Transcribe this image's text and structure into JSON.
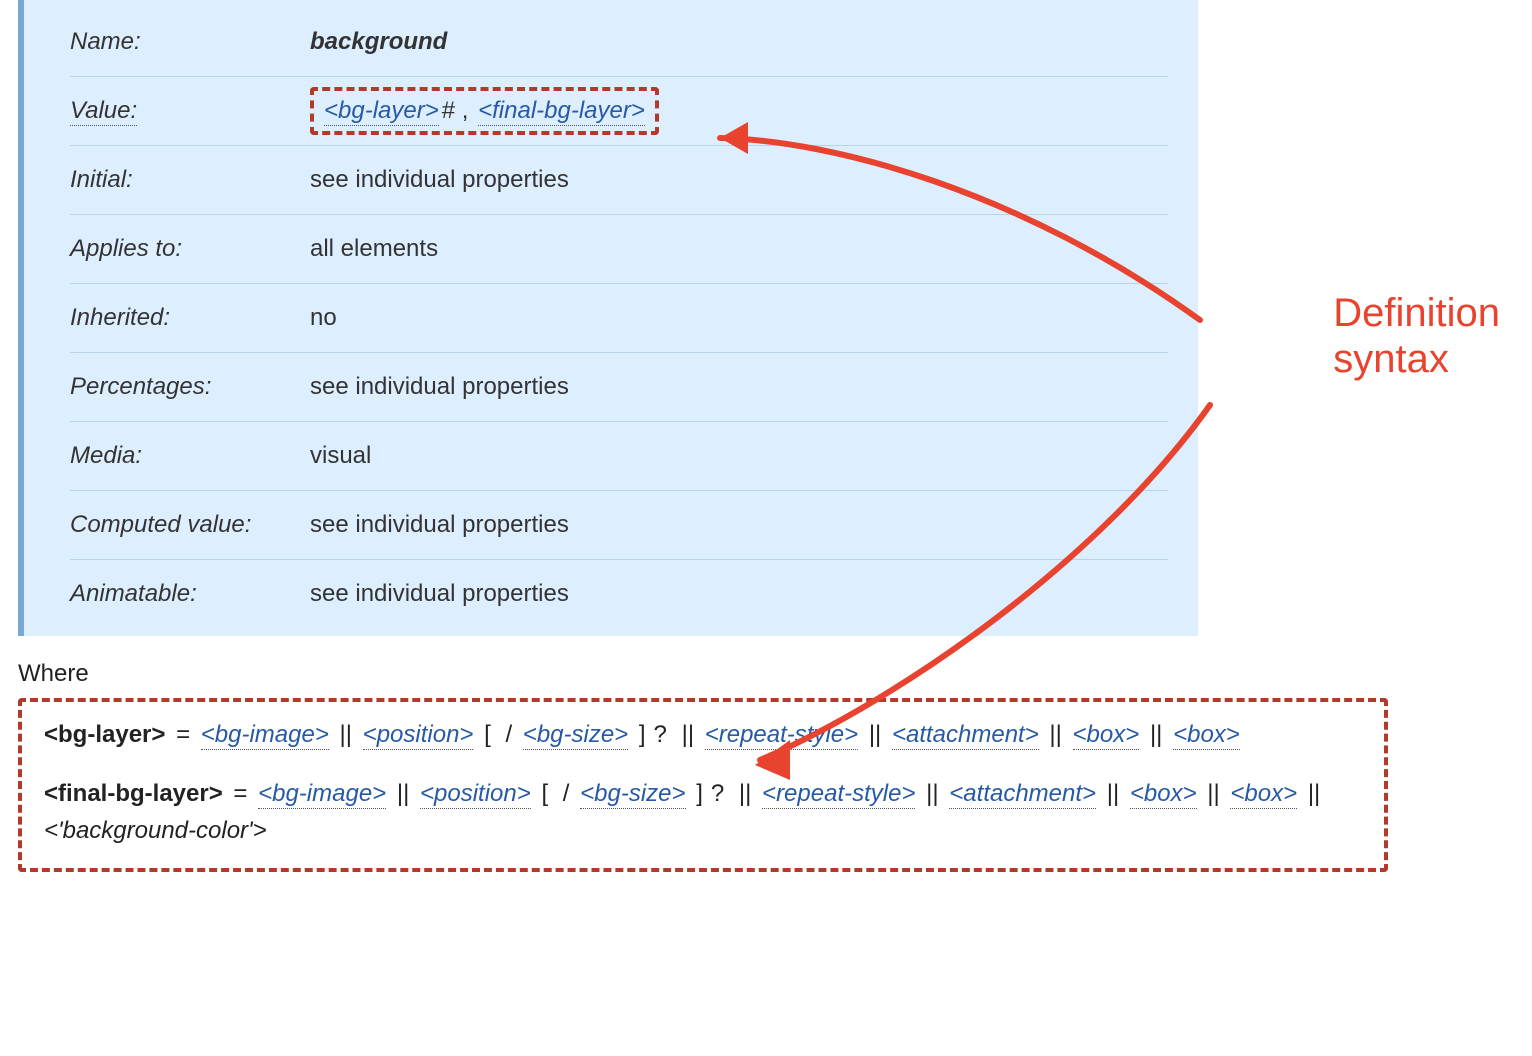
{
  "propdef": {
    "rows": [
      {
        "label": "Name:",
        "value_text": "background"
      },
      {
        "label": "Value:",
        "value_link1": "<bg-layer>",
        "value_sep": "# , ",
        "value_link2": "<final-bg-layer>"
      },
      {
        "label": "Initial:",
        "value_text": "see individual properties"
      },
      {
        "label": "Applies to:",
        "value_text": "all elements"
      },
      {
        "label": "Inherited:",
        "value_text": "no"
      },
      {
        "label": "Percentages:",
        "value_text": "see individual properties"
      },
      {
        "label": "Media:",
        "value_text": "visual"
      },
      {
        "label": "Computed value:",
        "value_text": "see individual properties"
      },
      {
        "label": "Animatable:",
        "value_text": "see individual properties"
      }
    ]
  },
  "where_heading": "Where",
  "where": {
    "line1_lhs": "<bg-layer>",
    "line2_lhs": "<final-bg-layer>",
    "eq": " = ",
    "tokens": {
      "bg_image": "<bg-image>",
      "position": "<position>",
      "bg_size": "<bg-size>",
      "repeat_style": "<repeat-style>",
      "attachment": "<attachment>",
      "box": "<box>",
      "bg_color": "<'background-color'>"
    },
    "ops": {
      "dbar": "||",
      "lbracket": "[",
      "rbracket": "]",
      "slash": "/",
      "qmark": "?"
    }
  },
  "annotation": {
    "line1": "Definition",
    "line2": "syntax"
  }
}
